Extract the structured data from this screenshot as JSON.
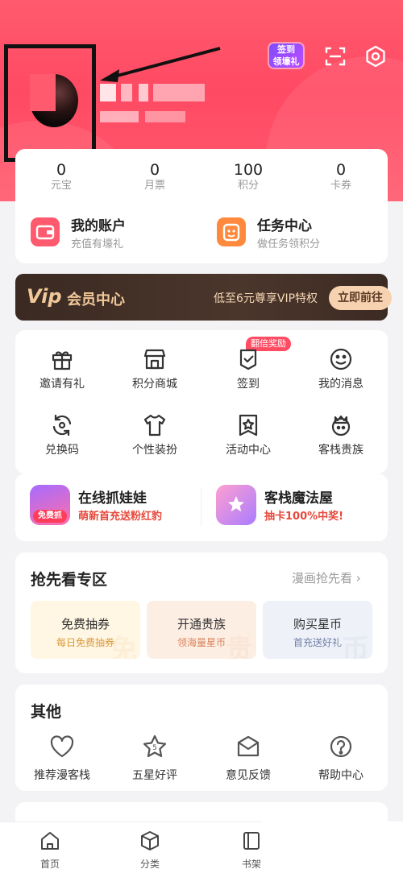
{
  "header": {
    "signin_badge_line1": "签到",
    "signin_badge_line2": "领壕礼",
    "scan_icon": "scan-icon",
    "settings_icon": "gear-icon"
  },
  "stats": [
    {
      "value": "0",
      "label": "元宝"
    },
    {
      "value": "0",
      "label": "月票"
    },
    {
      "value": "100",
      "label": "积分"
    },
    {
      "value": "0",
      "label": "卡券"
    }
  ],
  "quick": [
    {
      "title": "我的账户",
      "sub": "充值有壕礼",
      "icon": "wallet-icon"
    },
    {
      "title": "任务中心",
      "sub": "做任务领积分",
      "icon": "task-icon"
    }
  ],
  "vip": {
    "logo": "Vip",
    "title": "会员中心",
    "desc": "低至6元尊享VIP特权",
    "button": "立即前往"
  },
  "features": [
    {
      "label": "邀请有礼",
      "icon": "gift-icon"
    },
    {
      "label": "积分商城",
      "icon": "store-icon"
    },
    {
      "label": "签到",
      "icon": "checkin-icon"
    },
    {
      "label": "我的消息",
      "icon": "smile-message-icon"
    },
    {
      "label": "兑换码",
      "icon": "redeem-icon"
    },
    {
      "label": "个性装扮",
      "icon": "shirt-icon"
    },
    {
      "label": "活动中心",
      "icon": "activity-star-icon"
    },
    {
      "label": "客栈贵族",
      "icon": "crown-icon"
    }
  ],
  "features_badge": "翻倍奖励",
  "promos": [
    {
      "title": "在线抓娃娃",
      "sub": "萌新首充送粉红豹",
      "pic_label": "免费抓"
    },
    {
      "title": "客栈魔法屋",
      "sub": "抽卡100%中奖!"
    }
  ],
  "early": {
    "title": "抢先看专区",
    "more": "漫画抢先看 ›",
    "cards": [
      {
        "title": "免费抽券",
        "sub": "每日免费抽券",
        "color": "#d99a3a",
        "bg": "#fff6e3"
      },
      {
        "title": "开通贵族",
        "sub": "领海量星币",
        "color": "#d7835a",
        "bg": "#fdeee4"
      },
      {
        "title": "购买星币",
        "sub": "首充送好礼",
        "color": "#6e7fa6",
        "bg": "#eef1f8"
      }
    ]
  },
  "other": {
    "title": "其他",
    "items": [
      {
        "label": "推荐漫客栈",
        "icon": "heart-icon"
      },
      {
        "label": "五星好评",
        "icon": "five-star-icon"
      },
      {
        "label": "意见反馈",
        "icon": "feedback-icon"
      },
      {
        "label": "帮助中心",
        "icon": "help-icon"
      }
    ]
  },
  "tabs": [
    {
      "label": "首页",
      "icon": "home-icon"
    },
    {
      "label": "分类",
      "icon": "category-box-icon"
    },
    {
      "label": "书架",
      "icon": "bookshelf-icon"
    }
  ],
  "colors": {
    "header": "#ff5a6e",
    "accent": "#ff4c63",
    "vip_bg": "#3a2a22",
    "vip_gold": "#f1c89a"
  }
}
